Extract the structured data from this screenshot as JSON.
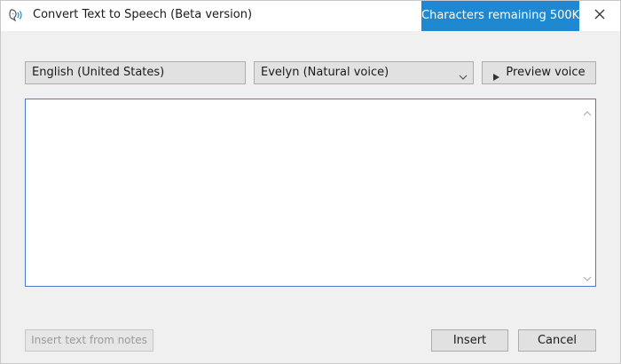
{
  "window": {
    "title": "Convert Text to Speech (Beta version)",
    "characters_remaining": "Characters remaining 500K",
    "accent_color": "#1e88d0"
  },
  "controls": {
    "language": "English (United States)",
    "voice": "Evelyn (Natural voice)",
    "preview_label": "Preview voice"
  },
  "editor": {
    "text": ""
  },
  "footer": {
    "insert_from_notes_label": "Insert text from notes",
    "insert_label": "Insert",
    "cancel_label": "Cancel"
  },
  "icons": {
    "app": "speech-bubble-icon",
    "close": "close-icon",
    "dropdown": "chevron-down-icon",
    "play": "play-icon"
  }
}
